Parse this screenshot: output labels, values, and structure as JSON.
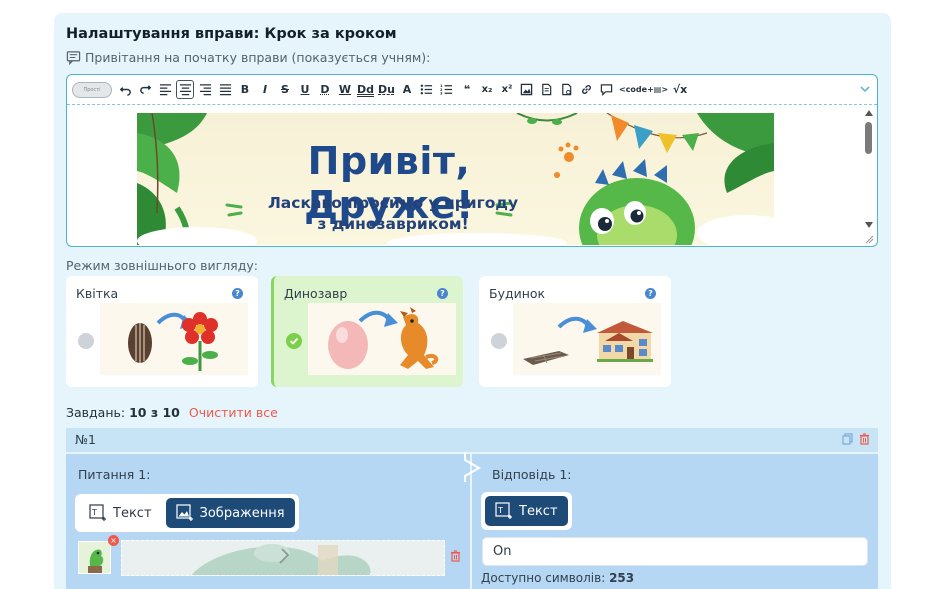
{
  "header": {
    "title": "Налаштування вправи: Крок за кроком",
    "greeting_label": "Привітання на початку вправи (показується учням):"
  },
  "toolbar": {
    "toggle_label": "Прості",
    "code_label": "<code+▤>",
    "buttons": [
      "undo-icon",
      "redo-icon",
      "align-left-icon",
      "align-center-icon",
      "align-right-icon",
      "align-justify-icon",
      "bold-icon",
      "italic-icon",
      "strikethrough-icon",
      "underline-icon",
      "dotted-underline-icon",
      "wavy-underline-icon",
      "double-underline-icon",
      "dashed-underline-icon",
      "clear-format-icon",
      "bullet-list-icon",
      "numbered-list-icon",
      "quote-icon",
      "subscript-icon",
      "superscript-icon",
      "image-icon",
      "document-icon",
      "file-icon",
      "link-icon",
      "comment-icon",
      "code-icon",
      "formula-icon"
    ],
    "labels": {
      "bold": "B",
      "italic": "I",
      "strike": "S",
      "underline": "U",
      "d1": "D",
      "w": "W",
      "dd": "Dd",
      "du": "Du",
      "clear": "A",
      "quote": "❝",
      "sub": "x₂",
      "sup": "x²",
      "formula": "√x"
    }
  },
  "banner": {
    "title": "Привіт, Друже!",
    "subtitle_line1": "Ласкаво просимо у пригоду",
    "subtitle_line2": "з динозавриком!"
  },
  "appearance": {
    "label": "Режим зовнішнього вигляду:",
    "modes": [
      {
        "name": "Квітка",
        "selected": false
      },
      {
        "name": "Динозавр",
        "selected": true
      },
      {
        "name": "Будинок",
        "selected": false
      }
    ],
    "help_glyph": "?"
  },
  "tasks": {
    "label": "Завдань:",
    "count": "10 з 10",
    "clear_all": "Очистити все"
  },
  "task": {
    "number": "№1",
    "question_label": "Питання 1:",
    "answer_label": "Відповідь 1:",
    "question_tabs": [
      {
        "label": "Текст",
        "active": false
      },
      {
        "label": "Зображення",
        "active": true
      }
    ],
    "answer_tabs": [
      {
        "label": "Текст",
        "active": true
      }
    ],
    "answer_value": "On",
    "chars_label": "Доступно символів:",
    "chars_value": "253",
    "remove_glyph": "×"
  },
  "colors": {
    "accent": "#1d4a76",
    "panel": "#e6f4fb",
    "selected_mode": "#dcf5cf",
    "danger": "#ef5a4c",
    "editor_border": "#4fb3c9"
  }
}
